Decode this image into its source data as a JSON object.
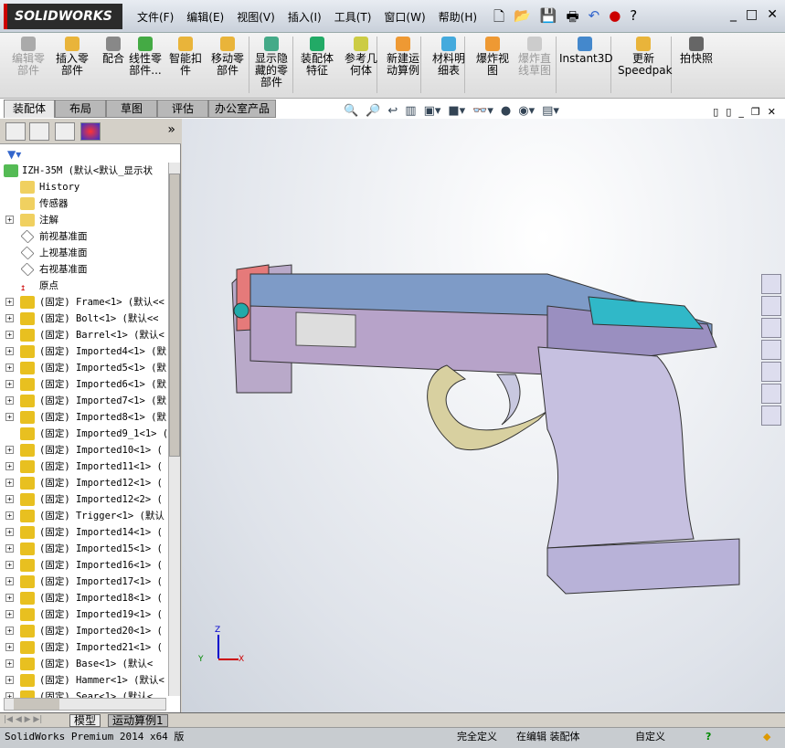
{
  "app": {
    "logo": "SOLIDWORKS"
  },
  "menu": [
    "文件(F)",
    "编辑(E)",
    "视图(V)",
    "插入(I)",
    "工具(T)",
    "窗口(W)",
    "帮助(H)"
  ],
  "ribbon": [
    {
      "label": "编辑零部件",
      "disabled": true
    },
    {
      "label": "插入零部件",
      "disabled": false
    },
    {
      "label": "配合",
      "disabled": false
    },
    {
      "label": "线性零部件...",
      "disabled": false
    },
    {
      "label": "智能扣件",
      "disabled": false
    },
    {
      "label": "移动零部件",
      "disabled": false
    },
    {
      "label": "显示隐藏的零部件",
      "disabled": false
    },
    {
      "label": "装配体特征",
      "disabled": false
    },
    {
      "label": "参考几何体",
      "disabled": false
    },
    {
      "label": "新建运动算例",
      "disabled": false
    },
    {
      "label": "材料明细表",
      "disabled": false
    },
    {
      "label": "爆炸视图",
      "disabled": false
    },
    {
      "label": "爆炸直线草图",
      "disabled": true
    },
    {
      "label": "Instant3D",
      "disabled": false
    },
    {
      "label": "更新Speedpak",
      "disabled": false
    },
    {
      "label": "拍快照",
      "disabled": false
    }
  ],
  "tabs": [
    "装配体",
    "布局",
    "草图",
    "评估",
    "办公室产品"
  ],
  "tree": [
    {
      "label": "IZH-35M  (默认<默认_显示状",
      "plus": false
    },
    {
      "label": "History",
      "plus": false
    },
    {
      "label": "传感器",
      "plus": false
    },
    {
      "label": "注解",
      "plus": true
    },
    {
      "label": "前视基准面",
      "plus": false
    },
    {
      "label": "上视基准面",
      "plus": false
    },
    {
      "label": "右视基准面",
      "plus": false
    },
    {
      "label": "原点",
      "plus": false
    },
    {
      "label": "(固定) Frame<1> (默认<<",
      "plus": true
    },
    {
      "label": "(固定) Bolt<1> (默认<<",
      "plus": true
    },
    {
      "label": "(固定) Barrel<1> (默认<",
      "plus": true
    },
    {
      "label": "(固定) Imported4<1> (默",
      "plus": true
    },
    {
      "label": "(固定) Imported5<1> (默",
      "plus": true
    },
    {
      "label": "(固定) Imported6<1> (默",
      "plus": true
    },
    {
      "label": "(固定) Imported7<1> (默",
      "plus": true
    },
    {
      "label": "(固定) Imported8<1> (默",
      "plus": true
    },
    {
      "label": "(固定) Imported9_1<1> (",
      "plus": false
    },
    {
      "label": "(固定) Imported10<1> (",
      "plus": true
    },
    {
      "label": "(固定) Imported11<1> (",
      "plus": true
    },
    {
      "label": "(固定) Imported12<1> (",
      "plus": true
    },
    {
      "label": "(固定) Imported12<2> (",
      "plus": true
    },
    {
      "label": "(固定) Trigger<1> (默认",
      "plus": true
    },
    {
      "label": "(固定) Imported14<1> (",
      "plus": true
    },
    {
      "label": "(固定) Imported15<1> (",
      "plus": true
    },
    {
      "label": "(固定) Imported16<1> (",
      "plus": true
    },
    {
      "label": "(固定) Imported17<1> (",
      "plus": true
    },
    {
      "label": "(固定) Imported18<1> (",
      "plus": true
    },
    {
      "label": "(固定) Imported19<1> (",
      "plus": true
    },
    {
      "label": "(固定) Imported20<1> (",
      "plus": true
    },
    {
      "label": "(固定) Imported21<1> (",
      "plus": true
    },
    {
      "label": "(固定) Base<1> (默认<",
      "plus": true
    },
    {
      "label": "(固定) Hammer<1> (默认<",
      "plus": true
    },
    {
      "label": "(固定) Sear<1> (默认<",
      "plus": true
    }
  ],
  "bottom_tabs": [
    "模型",
    "运动算例1"
  ],
  "status": {
    "product": "SolidWorks Premium 2014 x64 版",
    "defined": "完全定义",
    "editing": "在编辑 装配体",
    "custom": "自定义"
  },
  "triad": {
    "x": "X",
    "y": "Y",
    "z": "Z"
  }
}
